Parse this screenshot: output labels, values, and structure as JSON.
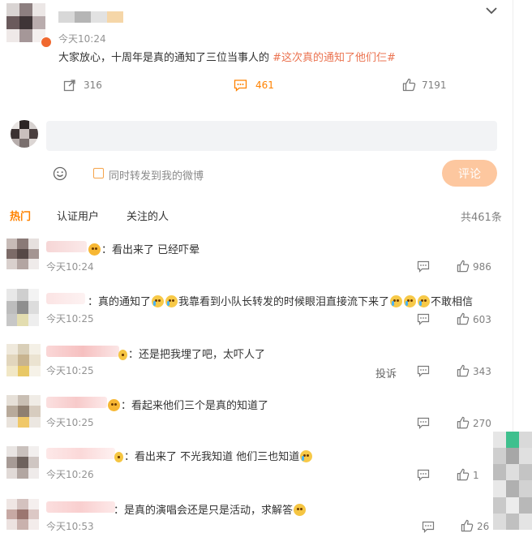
{
  "post": {
    "time": "今天10:24",
    "text_prefix": "大家放心，十周年是真的通知了三位当事人的 ",
    "hashtag": "#这次真的通知了他们仨#",
    "repost_count": "316",
    "comment_count": "461",
    "like_count": "7191"
  },
  "composer": {
    "repost_option": "同时转发到我的微博",
    "submit_label": "评论"
  },
  "tabs": {
    "hot": "热门",
    "verified": "认证用户",
    "following": "关注的人",
    "total": "共461条"
  },
  "comments": [
    {
      "text": "：看出来了 已经吓晕",
      "time": "今天10:24",
      "likes": "986"
    },
    {
      "text_a": "：真的通知了",
      "text_b": "我靠看到小队长转发的时候眼泪直接流下来了",
      "text_c": "不敢相信",
      "time": "今天10:25",
      "likes": "603"
    },
    {
      "text": "：还是把我埋了吧，太吓人了",
      "time": "今天10:25",
      "report": "投诉",
      "likes": "343"
    },
    {
      "text": "：看起来他们三个是真的知道了",
      "time": "今天10:25",
      "likes": "270"
    },
    {
      "text": "：看出来了 不光我知道 他们三也知道",
      "time": "今天10:26",
      "likes": "1"
    },
    {
      "text": "：是真的演唱会还是只是活动，求解答",
      "time": "今天10:53",
      "likes": "26"
    }
  ],
  "colors": {
    "accent": "#ff8200",
    "submit_bg": "#fdc79f",
    "input_bg": "#f2f3f5"
  }
}
